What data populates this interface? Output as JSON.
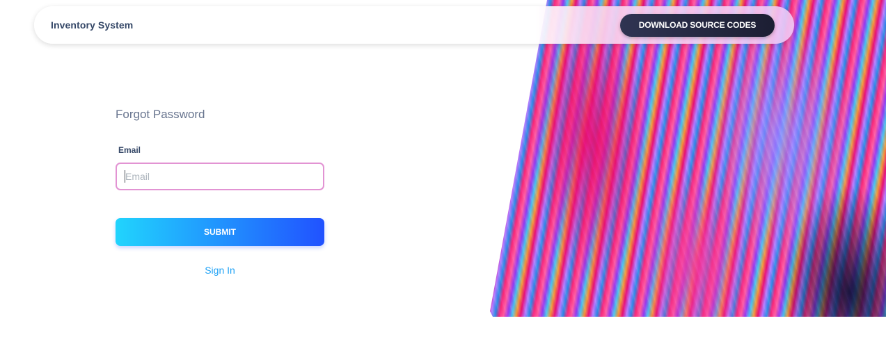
{
  "navbar": {
    "brand": "Inventory System",
    "download_label": "DOWNLOAD SOURCE CODES"
  },
  "form": {
    "title": "Forgot Password",
    "email_label": "Email",
    "email_placeholder": "Email",
    "email_value": "",
    "submit_label": "SUBMIT",
    "signin_label": "Sign In"
  },
  "colors": {
    "brand_text": "#344767",
    "input_focus_border": "#e293d3",
    "submit_gradient_start": "#21d4fd",
    "submit_gradient_end": "#2152ff",
    "link": "#1fa2f5",
    "download_button": "#1c1e33"
  },
  "decor": {
    "background_art": "colorful-wavy-abstract-image"
  }
}
